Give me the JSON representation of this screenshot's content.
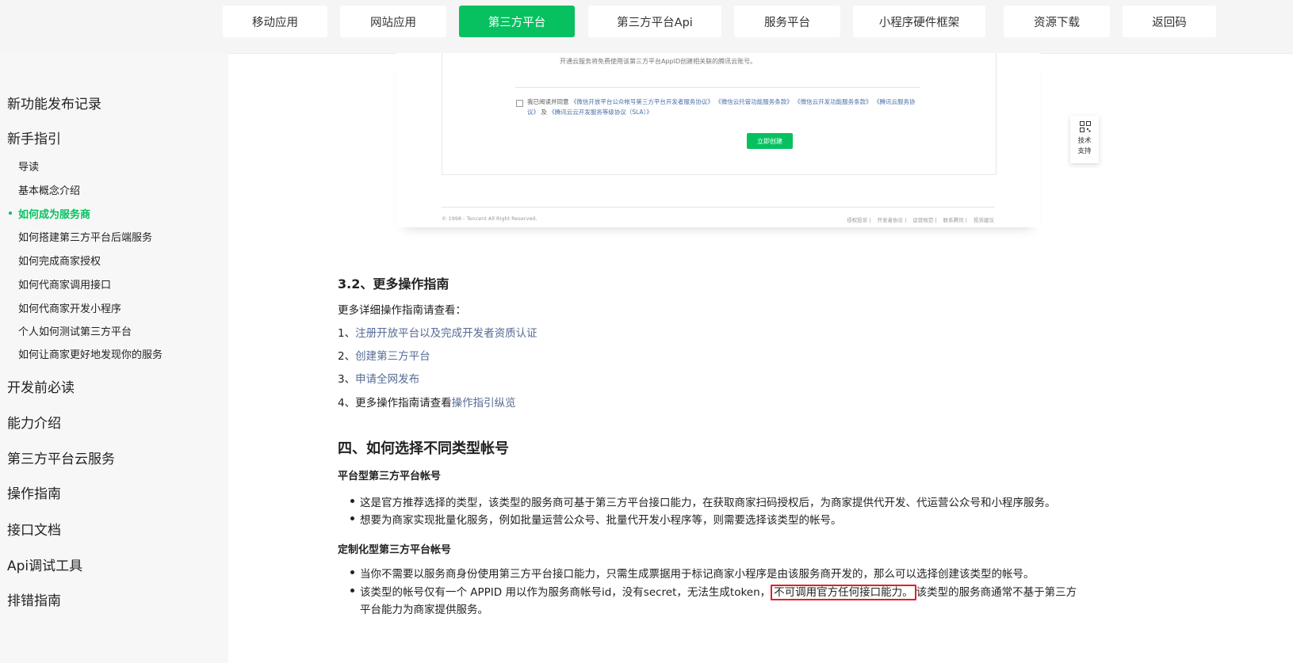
{
  "nav": {
    "tabs": [
      "移动应用",
      "网站应用",
      "第三方平台",
      "第三方平台Api",
      "服务平台",
      "小程序硬件框架",
      "资源下载",
      "返回码"
    ],
    "active_index": 2,
    "active_color": "#07c160"
  },
  "sidebar": {
    "items": [
      {
        "label": "新功能发布记录"
      },
      {
        "label": "新手指引"
      },
      {
        "label": "导读"
      },
      {
        "label": "基本概念介绍"
      },
      {
        "label": "如何成为服务商"
      },
      {
        "label": "如何搭建第三方平台后端服务"
      },
      {
        "label": "如何完成商家授权"
      },
      {
        "label": "如何代商家调用接口"
      },
      {
        "label": "如何代商家开发小程序"
      },
      {
        "label": "个人如何测试第三方平台"
      },
      {
        "label": "如何让商家更好地发现你的服务"
      },
      {
        "label": "开发前必读"
      },
      {
        "label": "能力介绍"
      },
      {
        "label": "第三方平台云服务"
      },
      {
        "label": "操作指南"
      },
      {
        "label": "接口文档"
      },
      {
        "label": "Api调试工具"
      },
      {
        "label": "排错指南"
      }
    ],
    "active": "如何成为服务商"
  },
  "screenshot": {
    "top_note": "开通云服务将免费使用该第三方平台AppID创建相关联的腾讯云账号。",
    "agree_prefix": "我已阅读并同意",
    "agree_links": [
      "《微信开放平台公众帐号第三方平台开发者服务协议》",
      "《微信云托管功能服务条款》",
      "《微信云开发功能服务条款》",
      "《腾讯云服务协议》"
    ],
    "agree_and": "及",
    "agree_last": "《腾讯云云开发服务等级协议（SLA）》",
    "create_button": "立即创建",
    "copyright": "© 1998 - Tencent All Right Reserved.",
    "footer_links": [
      "侵权投诉",
      "开发者协议",
      "运营规范",
      "联系腾讯",
      "投诉建议"
    ]
  },
  "support_widget": {
    "line1": "技术",
    "line2": "支持",
    "icon": "qrcode-icon"
  },
  "content": {
    "section32": {
      "title": "3.2、更多操作指南",
      "intro": "更多详细操作指南请查看：",
      "items": [
        {
          "prefix": "1、",
          "link": "注册开放平台以及完成开发者资质认证"
        },
        {
          "prefix": "2、",
          "link": "创建第三方平台"
        },
        {
          "prefix": "3、",
          "link": "申请全网发布"
        },
        {
          "prefix": "4、更多操作指南请查看",
          "link": "操作指引纵览"
        }
      ]
    },
    "section4": {
      "title": "四、如何选择不同类型帐号",
      "platform_title": "平台型第三方平台帐号",
      "platform_bullets": [
        "这是官方推荐选择的类型，该类型的服务商可基于第三方平台接口能力，在获取商家扫码授权后，为商家提供代开发、代运营公众号和小程序服务。",
        "想要为商家实现批量化服务，例如批量运营公众号、批量代开发小程序等，则需要选择该类型的帐号。"
      ],
      "custom_title": "定制化型第三方平台帐号",
      "custom_bullet1": "当你不需要以服务商身份使用第三方平台接口能力，只需生成票据用于标记商家小程序是由该服务商开发的，那么可以选择创建该类型的帐号。",
      "custom_bullet2_before": "该类型的帐号仅有一个 APPID 用以作为服务商帐号id，没有secret，无法生成token，",
      "custom_bullet2_highlight": "不可调用官方任何接口能力。",
      "custom_bullet2_after_line1": "该类型的服务商通常不基于第三方",
      "custom_bullet2_after_line2": "平台能力为商家提供服务。"
    }
  }
}
